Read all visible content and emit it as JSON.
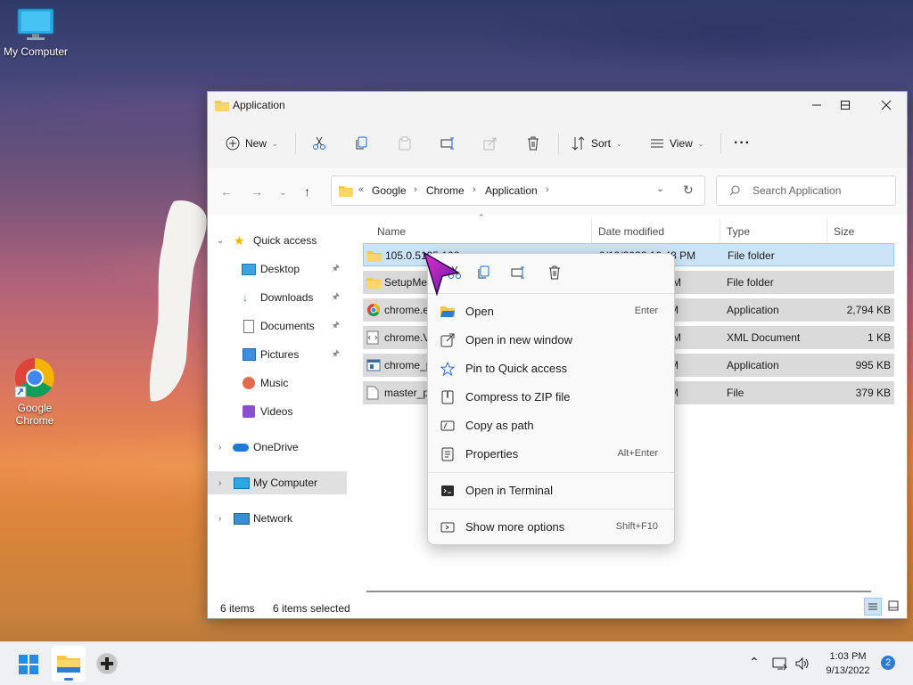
{
  "desktop": {
    "icons": [
      {
        "label": "My Computer"
      },
      {
        "label": "Google Chrome"
      }
    ]
  },
  "window": {
    "title": "Application",
    "toolbar": {
      "new_label": "New",
      "sort_label": "Sort",
      "view_label": "View",
      "more_glyph": "···"
    },
    "breadcrumb": {
      "overflow": "«",
      "items": [
        "Google",
        "Chrome",
        "Application"
      ]
    },
    "search": {
      "placeholder": "Search Application"
    },
    "nav": {
      "quick_access": "Quick access",
      "items": [
        "Desktop",
        "Downloads",
        "Documents",
        "Pictures",
        "Music",
        "Videos"
      ],
      "onedrive": "OneDrive",
      "my_computer": "My Computer",
      "network": "Network"
    },
    "columns": {
      "name": "Name",
      "date": "Date modified",
      "type": "Type",
      "size": "Size"
    },
    "files": [
      {
        "name": "105.0.5195.102",
        "date": "9/13/2022 10:48 PM",
        "type": "File folder",
        "size": ""
      },
      {
        "name": "SetupMe",
        "date": "PM",
        "type": "File folder",
        "size": ""
      },
      {
        "name": "chrome.e",
        "date": "M",
        "type": "Application",
        "size": "2,794 KB"
      },
      {
        "name": "chrome.V",
        "date": "PM",
        "type": "XML Document",
        "size": "1 KB"
      },
      {
        "name": "chrome_p",
        "date": "M",
        "type": "Application",
        "size": "995 KB"
      },
      {
        "name": "master_p",
        "date": "M",
        "type": "File",
        "size": "379 KB"
      }
    ],
    "status": {
      "items": "6 items",
      "selected": "6 items selected"
    }
  },
  "context_menu": {
    "items": [
      {
        "label": "Open",
        "shortcut": "Enter"
      },
      {
        "label": "Open in new window",
        "shortcut": ""
      },
      {
        "label": "Pin to Quick access",
        "shortcut": ""
      },
      {
        "label": "Compress to ZIP file",
        "shortcut": ""
      },
      {
        "label": "Copy as path",
        "shortcut": ""
      },
      {
        "label": "Properties",
        "shortcut": "Alt+Enter"
      },
      {
        "label": "Open in Terminal",
        "shortcut": ""
      },
      {
        "label": "Show more options",
        "shortcut": "Shift+F10"
      }
    ]
  },
  "taskbar": {
    "time": "1:03 PM",
    "date": "9/13/2022",
    "notification_count": "2"
  },
  "colors": {
    "accent": "#0067c0",
    "selection": "#cce4f7",
    "folder": "#f8c74a"
  }
}
